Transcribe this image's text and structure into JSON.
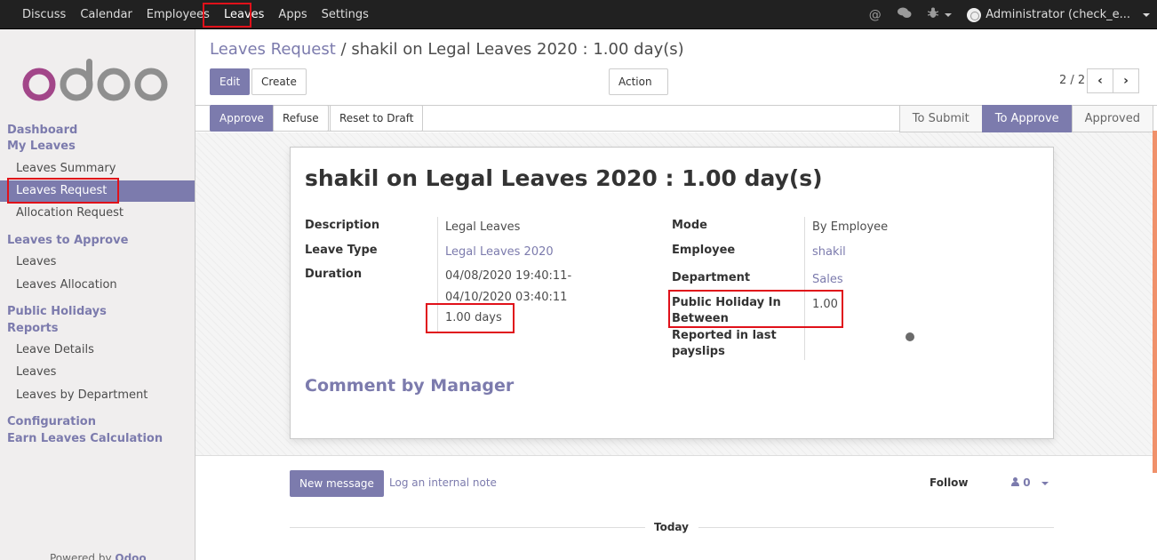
{
  "topbar": {
    "menu": [
      "Discuss",
      "Calendar",
      "Employees",
      "Leaves",
      "Apps",
      "Settings"
    ],
    "active": "Leaves",
    "user_label": "Administrator (check_e..."
  },
  "sidebar": {
    "logo": "odoo",
    "sections": {
      "dashboard": "Dashboard",
      "my_leaves": "My Leaves",
      "leaves_summary": "Leaves Summary",
      "leaves_request": "Leaves Request",
      "allocation_request": "Allocation Request",
      "leaves_to_approve": "Leaves to Approve",
      "leaves": "Leaves",
      "leaves_allocation": "Leaves Allocation",
      "public_holidays": "Public Holidays",
      "reports": "Reports",
      "leave_details": "Leave Details",
      "leaves_report": "Leaves",
      "leaves_by_department": "Leaves by Department",
      "configuration": "Configuration",
      "earn_leaves_calculation": "Earn Leaves Calculation"
    },
    "powered_prefix": "Powered by",
    "powered_brand": "Odoo"
  },
  "control_panel": {
    "breadcrumb_parent": "Leaves Request",
    "breadcrumb_sep": "/",
    "breadcrumb_current": "shakil on Legal Leaves 2020 : 1.00 day(s)",
    "edit_label": "Edit",
    "create_label": "Create",
    "action_label": "Action",
    "pager": "2 / 2",
    "prev_icon": "‹",
    "next_icon": "›"
  },
  "statusbar": {
    "approve_label": "Approve",
    "refuse_label": "Refuse",
    "reset_label": "Reset to Draft",
    "states": [
      "To Submit",
      "To Approve",
      "Approved"
    ],
    "current_state": "To Approve"
  },
  "form": {
    "title": "shakil on Legal Leaves 2020 : 1.00 day(s)",
    "description_label": "Description",
    "description_value": "Legal Leaves",
    "leave_type_label": "Leave Type",
    "leave_type_value": "Legal Leaves 2020",
    "duration_label": "Duration",
    "duration_from": "04/08/2020 19:40:11-",
    "duration_to": "04/10/2020 03:40:11",
    "duration_days": "1.00 days",
    "mode_label": "Mode",
    "mode_value": "By Employee",
    "employee_label": "Employee",
    "employee_value": "shakil",
    "department_label": "Department",
    "department_value": "Sales",
    "public_holiday_label_1": "Public Holiday In",
    "public_holiday_label_2": "Between",
    "public_holiday_value": "1.00",
    "reported_label_1": "Reported in last",
    "reported_label_2": "payslips",
    "comment_heading": "Comment by Manager"
  },
  "chatter": {
    "new_message_label": "New message",
    "log_note_label": "Log an internal note",
    "follow_label": "Follow",
    "followers_count": "0",
    "today_label": "Today"
  }
}
